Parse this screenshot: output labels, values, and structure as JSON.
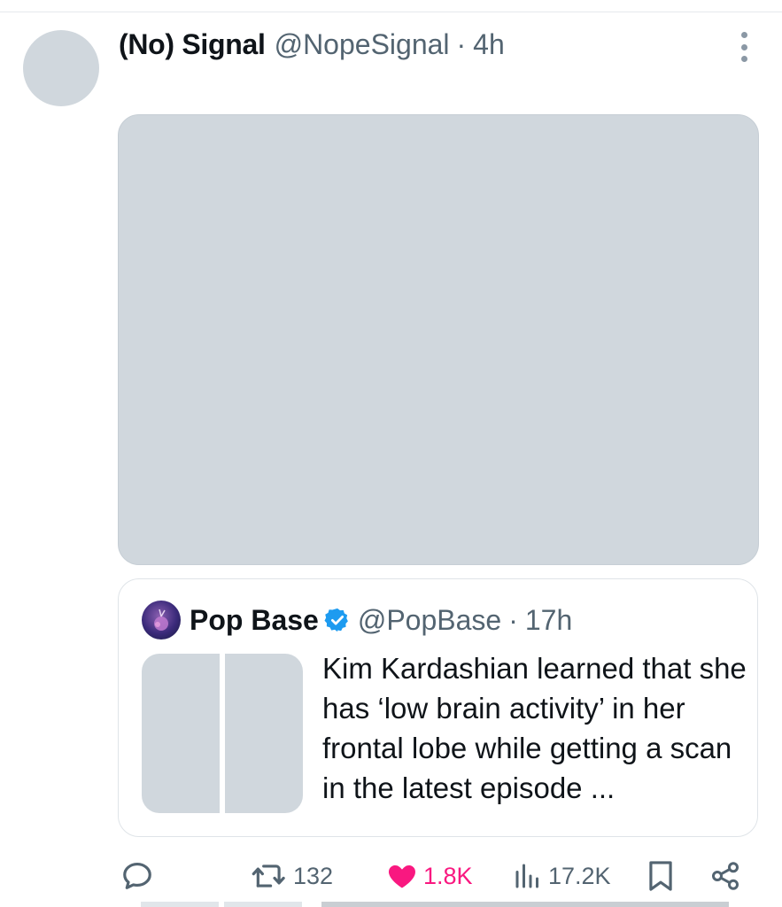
{
  "post": {
    "display_name": "(No) Signal",
    "handle": "@NopeSignal",
    "separator": "·",
    "time": "4h"
  },
  "quoted_post": {
    "display_name": "Pop Base",
    "handle": "@PopBase",
    "separator": "·",
    "time": "17h",
    "verified": true,
    "text": "Kim Kardashian learned that she has ‘low brain activity’ in her frontal lobe while getting a scan in the latest episode ..."
  },
  "actions": {
    "replies_icon": "reply-icon",
    "reposts": "132",
    "likes": "1.8K",
    "likes_state": "liked",
    "views": "17.2K",
    "bookmark_icon": "bookmark-icon",
    "share_icon": "share-icon"
  },
  "colors": {
    "like_active": "#f91880",
    "verified_badge": "#1d9bf0",
    "muted_text": "#536471",
    "placeholder": "#d0d7dd"
  }
}
